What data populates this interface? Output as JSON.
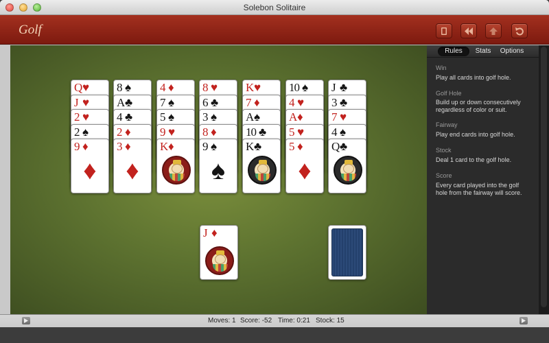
{
  "window": {
    "title": "Solebon Solitaire"
  },
  "toolbar": {
    "game_name": "Golf",
    "buttons": [
      {
        "name": "deck-icon"
      },
      {
        "name": "rewind-icon"
      },
      {
        "name": "upload-icon"
      },
      {
        "name": "undo-icon"
      }
    ]
  },
  "tableau": [
    {
      "cards": [
        {
          "rank": "Q",
          "suit": "♥",
          "color": "red"
        },
        {
          "rank": "J",
          "suit": "♥",
          "color": "red"
        },
        {
          "rank": "2",
          "suit": "♥",
          "color": "red"
        },
        {
          "rank": "2",
          "suit": "♠",
          "color": "black"
        },
        {
          "rank": "9",
          "suit": "♦",
          "color": "red",
          "face": "pip"
        }
      ]
    },
    {
      "cards": [
        {
          "rank": "8",
          "suit": "♠",
          "color": "black"
        },
        {
          "rank": "A",
          "suit": "♣",
          "color": "black"
        },
        {
          "rank": "4",
          "suit": "♣",
          "color": "black"
        },
        {
          "rank": "2",
          "suit": "♦",
          "color": "red"
        },
        {
          "rank": "3",
          "suit": "♦",
          "color": "red",
          "face": "pip"
        }
      ]
    },
    {
      "cards": [
        {
          "rank": "4",
          "suit": "♦",
          "color": "red"
        },
        {
          "rank": "7",
          "suit": "♠",
          "color": "black"
        },
        {
          "rank": "5",
          "suit": "♠",
          "color": "black"
        },
        {
          "rank": "9",
          "suit": "♥",
          "color": "red"
        },
        {
          "rank": "K",
          "suit": "♦",
          "color": "red",
          "face": "court"
        }
      ]
    },
    {
      "cards": [
        {
          "rank": "8",
          "suit": "♥",
          "color": "red"
        },
        {
          "rank": "6",
          "suit": "♣",
          "color": "black"
        },
        {
          "rank": "3",
          "suit": "♠",
          "color": "black"
        },
        {
          "rank": "8",
          "suit": "♦",
          "color": "red"
        },
        {
          "rank": "9",
          "suit": "♠",
          "color": "black",
          "face": "pip"
        }
      ]
    },
    {
      "cards": [
        {
          "rank": "K",
          "suit": "♥",
          "color": "red"
        },
        {
          "rank": "7",
          "suit": "♦",
          "color": "red"
        },
        {
          "rank": "A",
          "suit": "♠",
          "color": "black"
        },
        {
          "rank": "10",
          "suit": "♣",
          "color": "black"
        },
        {
          "rank": "K",
          "suit": "♣",
          "color": "black",
          "face": "court"
        }
      ]
    },
    {
      "cards": [
        {
          "rank": "10",
          "suit": "♠",
          "color": "black"
        },
        {
          "rank": "4",
          "suit": "♥",
          "color": "red"
        },
        {
          "rank": "A",
          "suit": "♦",
          "color": "red"
        },
        {
          "rank": "5",
          "suit": "♥",
          "color": "red"
        },
        {
          "rank": "5",
          "suit": "♦",
          "color": "red",
          "face": "pip"
        }
      ]
    },
    {
      "cards": [
        {
          "rank": "J",
          "suit": "♣",
          "color": "black"
        },
        {
          "rank": "3",
          "suit": "♣",
          "color": "black"
        },
        {
          "rank": "7",
          "suit": "♥",
          "color": "red"
        },
        {
          "rank": "4",
          "suit": "♠",
          "color": "black"
        },
        {
          "rank": "Q",
          "suit": "♣",
          "color": "black",
          "face": "court"
        }
      ]
    }
  ],
  "waste": {
    "rank": "J",
    "suit": "♦",
    "color": "red",
    "face": "court"
  },
  "stock": {
    "face": "down"
  },
  "sidebar": {
    "tabs": [
      "Rules",
      "Stats",
      "Options"
    ],
    "active_tab": "Rules",
    "rules": [
      {
        "heading": "Win",
        "text": "Play all cards into golf hole."
      },
      {
        "heading": "Golf Hole",
        "text": "Build up or down consecutively regardless of color or suit."
      },
      {
        "heading": "Fairway",
        "text": "Play end cards into golf hole."
      },
      {
        "heading": "Stock",
        "text": "Deal 1 card to the golf hole."
      },
      {
        "heading": "Score",
        "text": "Every card played into the golf hole from the fairway will score."
      }
    ]
  },
  "status": {
    "moves_label": "Moves:",
    "moves": "1",
    "score_label": "Score:",
    "score": "-52",
    "time_label": "Time:",
    "time": "0:21",
    "stock_label": "Stock:",
    "stock": "15"
  },
  "colors": {
    "toolbar": "#8f2515",
    "felt": "#5d7230",
    "red_suit": "#c2221e",
    "sidebar": "#2b2b2b"
  }
}
